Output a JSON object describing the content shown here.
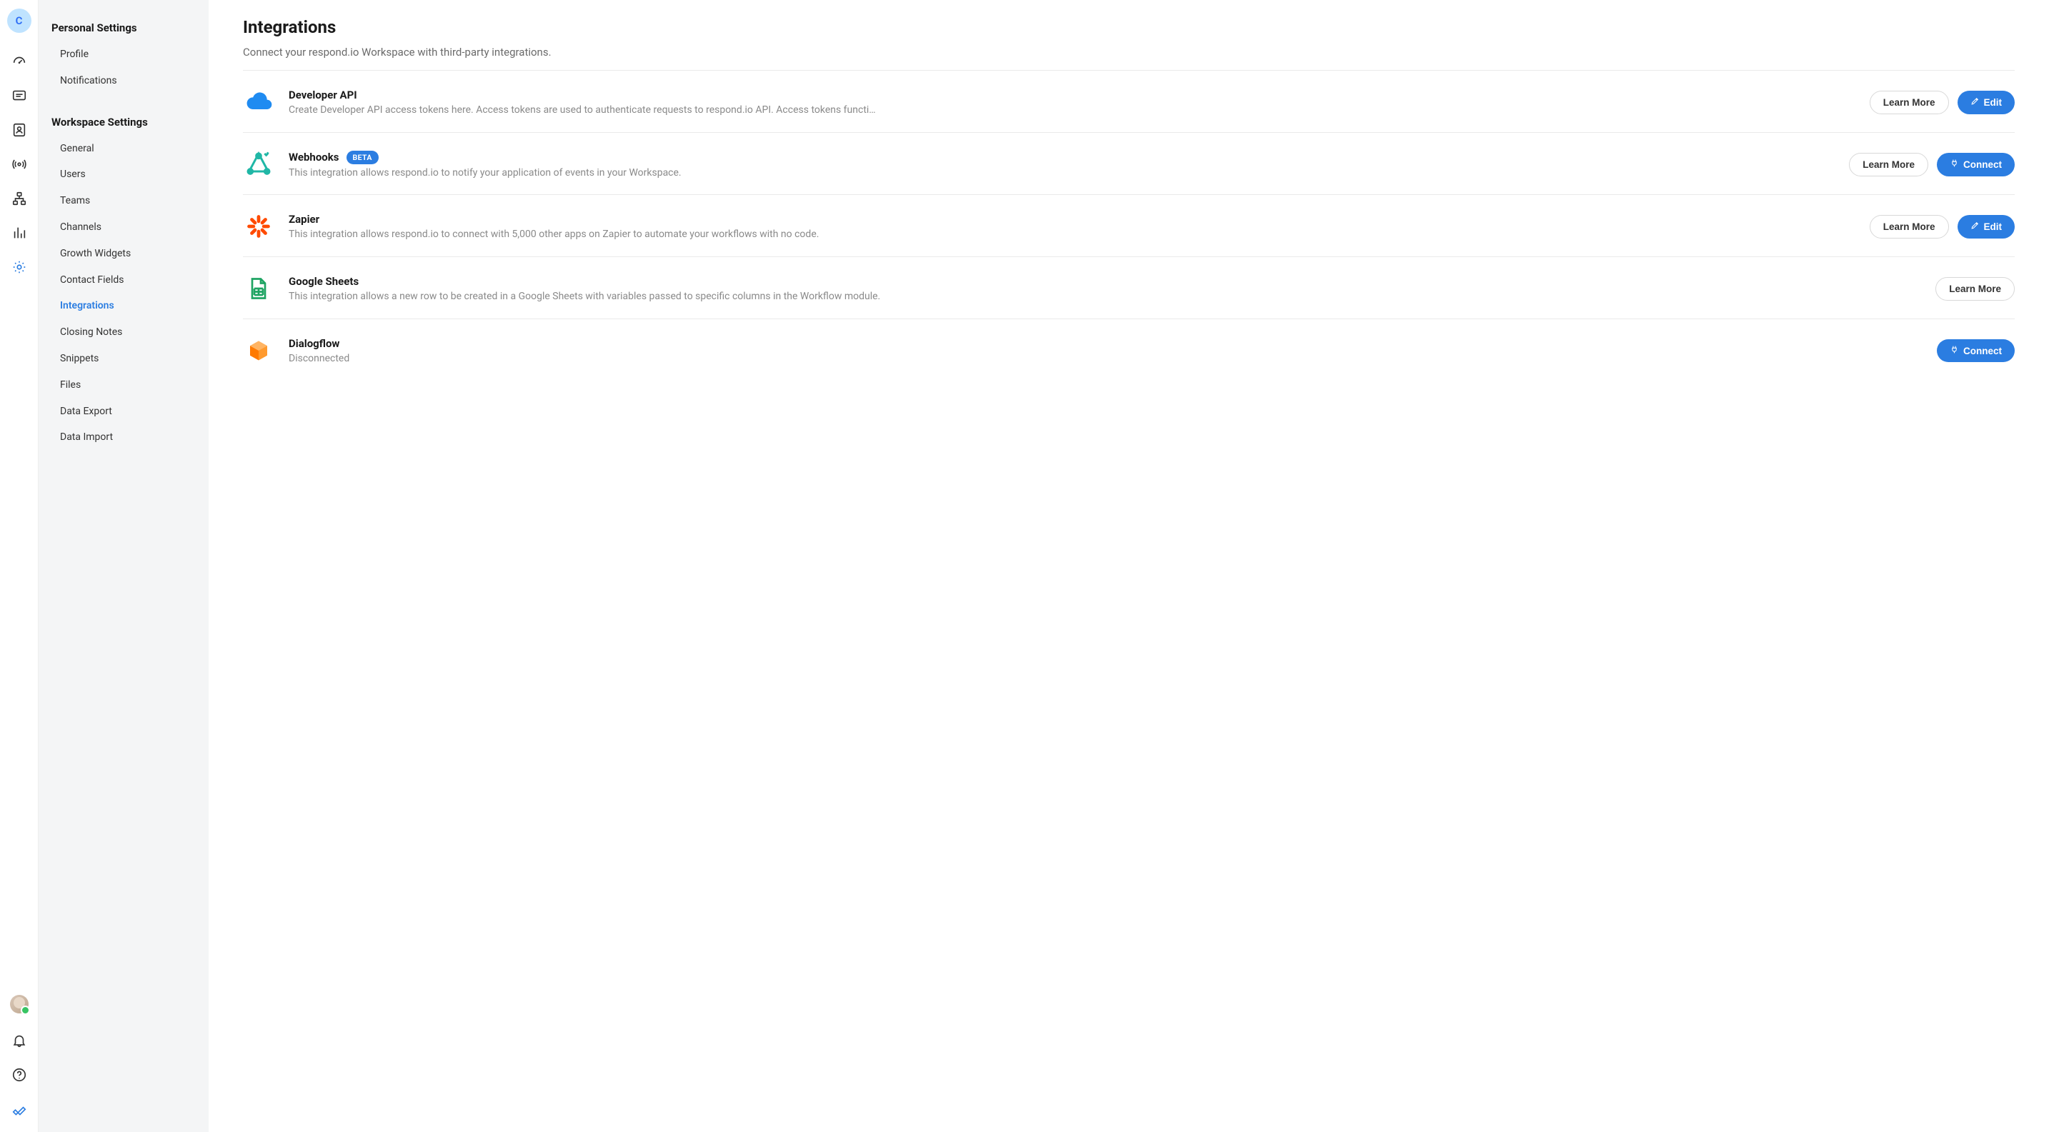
{
  "rail": {
    "avatar_letter": "C"
  },
  "sidebar": {
    "personal": {
      "title": "Personal Settings",
      "items": [
        "Profile",
        "Notifications"
      ]
    },
    "workspace": {
      "title": "Workspace Settings",
      "items": [
        "General",
        "Users",
        "Teams",
        "Channels",
        "Growth Widgets",
        "Contact Fields",
        "Integrations",
        "Closing Notes",
        "Snippets",
        "Files",
        "Data Export",
        "Data Import"
      ],
      "active_index": 6
    }
  },
  "page": {
    "title": "Integrations",
    "subtitle": "Connect your respond.io Workspace with third-party integrations."
  },
  "buttons": {
    "learn_more": "Learn More",
    "edit": "Edit",
    "connect": "Connect"
  },
  "badge": {
    "beta": "BETA"
  },
  "integrations": [
    {
      "id": "developer-api",
      "title": "Developer API",
      "desc": "Create Developer API access tokens here. Access tokens are used to authenticate requests to respond.io API. Access tokens functi…",
      "icon": "cloud",
      "actions": [
        "learn_more",
        "edit"
      ]
    },
    {
      "id": "webhooks",
      "title": "Webhooks",
      "badge": "beta",
      "desc": "This integration allows respond.io to notify your application of events in your Workspace.",
      "icon": "webhooks",
      "actions": [
        "learn_more",
        "connect"
      ]
    },
    {
      "id": "zapier",
      "title": "Zapier",
      "desc": "This integration allows respond.io to connect with 5,000 other apps on Zapier to automate your workflows with no code.",
      "icon": "zapier",
      "actions": [
        "learn_more",
        "edit"
      ]
    },
    {
      "id": "google-sheets",
      "title": "Google Sheets",
      "desc": "This integration allows a new row to be created in a Google Sheets with variables passed to specific columns in the Workflow module.",
      "icon": "sheets",
      "actions": [
        "learn_more"
      ]
    },
    {
      "id": "dialogflow",
      "title": "Dialogflow",
      "desc": "Disconnected",
      "icon": "cube",
      "actions": [
        "connect"
      ]
    }
  ]
}
